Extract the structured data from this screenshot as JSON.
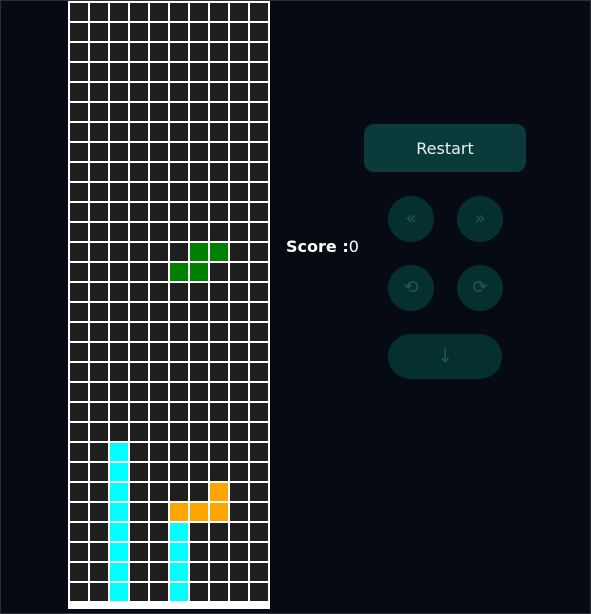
{
  "game": {
    "cols": 10,
    "rows": 30,
    "colors": {
      "empty": "#1f1f1f",
      "grid": "#ffffff",
      "I": "#00ffff",
      "L": "#ffa500",
      "S": "#008000"
    },
    "filled_cells": [
      {
        "row": 12,
        "col": 6,
        "piece": "S"
      },
      {
        "row": 12,
        "col": 7,
        "piece": "S"
      },
      {
        "row": 13,
        "col": 5,
        "piece": "S"
      },
      {
        "row": 13,
        "col": 6,
        "piece": "S"
      },
      {
        "row": 22,
        "col": 2,
        "piece": "I"
      },
      {
        "row": 23,
        "col": 2,
        "piece": "I"
      },
      {
        "row": 24,
        "col": 2,
        "piece": "I"
      },
      {
        "row": 25,
        "col": 2,
        "piece": "I"
      },
      {
        "row": 26,
        "col": 2,
        "piece": "I"
      },
      {
        "row": 27,
        "col": 2,
        "piece": "I"
      },
      {
        "row": 28,
        "col": 2,
        "piece": "I"
      },
      {
        "row": 29,
        "col": 2,
        "piece": "I"
      },
      {
        "row": 24,
        "col": 7,
        "piece": "L"
      },
      {
        "row": 25,
        "col": 5,
        "piece": "L"
      },
      {
        "row": 25,
        "col": 6,
        "piece": "L"
      },
      {
        "row": 25,
        "col": 7,
        "piece": "L"
      },
      {
        "row": 26,
        "col": 5,
        "piece": "I"
      },
      {
        "row": 27,
        "col": 5,
        "piece": "I"
      },
      {
        "row": 28,
        "col": 5,
        "piece": "I"
      },
      {
        "row": 29,
        "col": 5,
        "piece": "I"
      }
    ]
  },
  "score": {
    "label": "Score :",
    "value": "0"
  },
  "controls": {
    "restart_label": "Restart",
    "left_glyph": "«",
    "right_glyph": "»",
    "rotate_left_glyph": "⟲",
    "rotate_right_glyph": "⟳",
    "drop_glyph": "↓",
    "left_icon": "double-chevron-left-icon",
    "right_icon": "double-chevron-right-icon",
    "rotate_left_icon": "rotate-left-icon",
    "rotate_right_icon": "rotate-right-icon",
    "drop_icon": "arrow-down-icon"
  }
}
